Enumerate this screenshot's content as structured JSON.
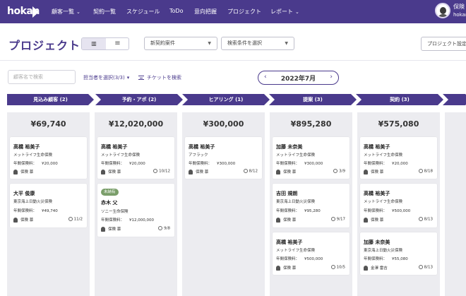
{
  "nav": {
    "logo": "hokan",
    "items": [
      {
        "label": "顧客一覧",
        "dropdown": true
      },
      {
        "label": "契約一覧",
        "dropdown": false
      },
      {
        "label": "スケジュール",
        "dropdown": false
      },
      {
        "label": "ToDo",
        "dropdown": false
      },
      {
        "label": "意向把握",
        "dropdown": false
      },
      {
        "label": "プロジェクト",
        "dropdown": false
      },
      {
        "label": "レポート",
        "dropdown": true
      }
    ],
    "user_name": "保険",
    "user_sub": "hokan"
  },
  "header": {
    "title": "プロジェクト",
    "view_board_icon": "board-view-icon",
    "view_list_icon": "list-view-icon",
    "contract_select": "新契約案件",
    "condition_select": "検索条件を選択",
    "settings_button": "プロジェクト設定"
  },
  "filters": {
    "search_placeholder": "顧客名で検索",
    "owner_select": "担当者を選択(3/3)",
    "ticket_search": "チケットを検索",
    "month": "2022年7月",
    "prev": "‹",
    "next": "›"
  },
  "stages": [
    {
      "label": "見込み顧客 (2)"
    },
    {
      "label": "予約・アポ (2)"
    },
    {
      "label": "ヒアリング (1)"
    },
    {
      "label": "提案 (3)"
    },
    {
      "label": "契約 (3)"
    }
  ],
  "columns": [
    {
      "total": "¥69,740",
      "cards": [
        {
          "name": "高橋 裕美子",
          "insurer": "メットライフ生命保険",
          "premium_label": "年間保険料：",
          "premium": "¥20,000",
          "person": "保険 慕",
          "date": ""
        },
        {
          "name": "大平 俊康",
          "insurer": "東京海上日動火災保険",
          "premium_label": "年間保険料：",
          "premium": "¥49,740",
          "person": "保険 慕",
          "date": "11/2"
        }
      ]
    },
    {
      "total": "¥12,020,000",
      "cards": [
        {
          "name": "高橋 裕美子",
          "insurer": "メットライフ生命保険",
          "premium_label": "年間保険料：",
          "premium": "¥20,000",
          "person": "保険 慕",
          "date": "10/12"
        },
        {
          "badge": "未納有",
          "name": "赤木 父",
          "insurer": "ソニー生命保険",
          "premium_label": "年間保険料：",
          "premium": "¥12,000,000",
          "person": "保険 慕",
          "date": "9/8"
        }
      ]
    },
    {
      "total": "¥300,000",
      "cards": [
        {
          "name": "高橋 裕美子",
          "insurer": "アフラック",
          "premium_label": "年間保険料：",
          "premium": "¥300,000",
          "person": "保険 慕",
          "date": "8/12"
        }
      ]
    },
    {
      "total": "¥895,280",
      "cards": [
        {
          "name": "加藤 未奈美",
          "insurer": "メットライフ生命保険",
          "premium_label": "年間保険料：",
          "premium": "¥300,000",
          "person": "保険 慕",
          "date": "3/9"
        },
        {
          "name": "吉田 規朗",
          "insurer": "東京海上日動火災保険",
          "premium_label": "年間保険料：",
          "premium": "¥95,280",
          "person": "保険 慕",
          "date": "9/17"
        },
        {
          "name": "高橋 裕美子",
          "insurer": "メットライフ生命保険",
          "premium_label": "年間保険料：",
          "premium": "¥500,000",
          "person": "保険 慕",
          "date": "10/5"
        }
      ]
    },
    {
      "total": "¥575,080",
      "cards": [
        {
          "name": "高橋 裕美子",
          "insurer": "メットライフ生命保険",
          "premium_label": "年間保険料：",
          "premium": "¥20,000",
          "person": "保険 慕",
          "date": "8/18"
        },
        {
          "name": "高橋 裕美子",
          "insurer": "メットライフ生命保険",
          "premium_label": "年間保険料：",
          "premium": "¥500,000",
          "person": "保険 慕",
          "date": "8/13"
        },
        {
          "name": "加藤 未奈美",
          "insurer": "東京海上日動火災保険",
          "premium_label": "年間保険料：",
          "premium": "¥55,080",
          "person": "金澤 雷吉",
          "date": "8/13"
        }
      ]
    }
  ],
  "colors": {
    "brand": "#4a3a8c",
    "column_bg": "#ececf0",
    "badge": "#7a9e6a"
  }
}
